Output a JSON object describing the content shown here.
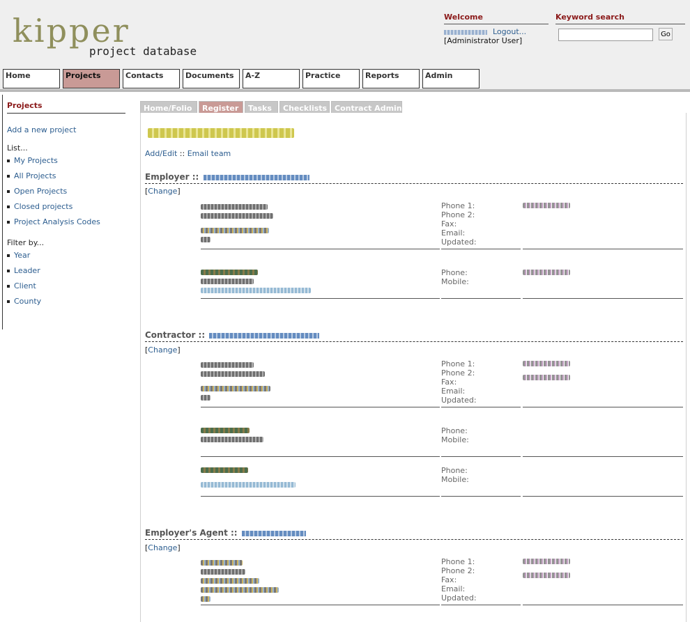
{
  "header": {
    "logo_word": "kipper",
    "logo_sub": "project database",
    "welcome_title": "Welcome",
    "logout_label": "Logout...",
    "user_role": "[Administrator User]",
    "search_title": "Keyword search",
    "search_value": "",
    "go_label": "Go"
  },
  "nav": {
    "tabs": [
      "Home",
      "Projects",
      "Contacts",
      "Documents",
      "A-Z",
      "Practice",
      "Reports",
      "Admin"
    ],
    "active": "Projects"
  },
  "sidebar": {
    "title": "Projects",
    "add_link": "Add a new project",
    "list_label": "List...",
    "list_items": [
      "My Projects",
      "All Projects",
      "Open Projects",
      "Closed projects",
      "Project Analysis Codes"
    ],
    "filter_label": "Filter by...",
    "filter_items": [
      "Year",
      "Leader",
      "Client",
      "County"
    ]
  },
  "content_tabs": {
    "tabs": [
      "Home/Folio",
      "Register",
      "Tasks",
      "Checklists",
      "Contract Admin"
    ],
    "active": "Register"
  },
  "register": {
    "add_edit": "Add/Edit",
    "separator": " :: ",
    "email_team": "Email team",
    "change_label": "Change",
    "sections": [
      {
        "label": "Employer ::",
        "org_labels": [
          "Phone 1:",
          "Phone 2:",
          "Fax:",
          "Email:",
          "Updated:"
        ],
        "person_labels": [
          [
            "Phone:",
            "Mobile:"
          ]
        ]
      },
      {
        "label": "Contractor ::",
        "org_labels": [
          "Phone 1:",
          "Phone 2:",
          "Fax:",
          "Email:",
          "Updated:"
        ],
        "person_labels": [
          [
            "Phone:",
            "Mobile:"
          ],
          [
            "Phone:",
            "Mobile:"
          ]
        ]
      },
      {
        "label": "Employer's Agent ::",
        "org_labels": [
          "Phone 1:",
          "Phone 2:",
          "Fax:",
          "Email:",
          "Updated:"
        ],
        "person_labels": []
      }
    ]
  },
  "colors": {
    "accent_red": "#8b1a1a",
    "active_tab": "#c99a96",
    "inactive_tab": "#c7c7c7",
    "link": "#2c5d8f",
    "logo": "#8f8f5c"
  }
}
